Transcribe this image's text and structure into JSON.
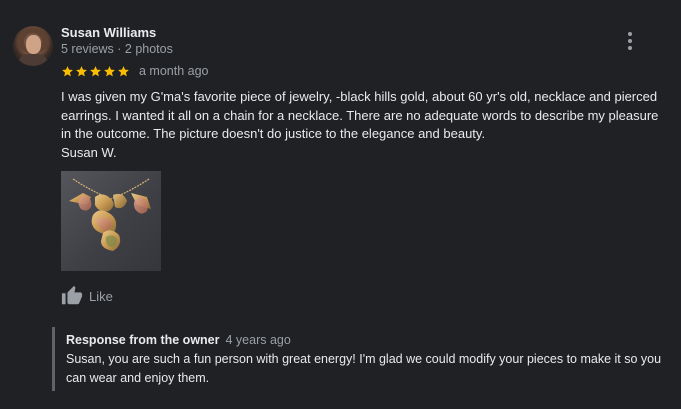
{
  "review": {
    "author": "Susan Williams",
    "author_meta": "5 reviews · 2 photos",
    "rating": 5,
    "max_rating": 5,
    "time": "a month ago",
    "lines": [
      "I was given my G'ma's favorite piece of jewelry, -black hills gold, about 60 yr's old, necklace and pierced earrings.  I wanted it all on a chain for a necklace.  There are no adequate words to describe my pleasure in the outcome.  The picture doesn't do justice to the elegance and beauty.",
      "Susan W."
    ],
    "like_label": "Like",
    "icons": {
      "menu": "more-vert-icon",
      "like": "thumbs-up-icon",
      "star": "star-icon"
    },
    "colors": {
      "star": "#fbbc04",
      "muted": "#9aa0a6",
      "text": "#e8eaed",
      "background": "#202124"
    }
  },
  "owner_response": {
    "title": "Response from the owner",
    "time": "4 years ago",
    "text": "Susan, you are such a fun person with great energy! I'm glad we could modify your pieces to make it so you can wear and enjoy them."
  }
}
